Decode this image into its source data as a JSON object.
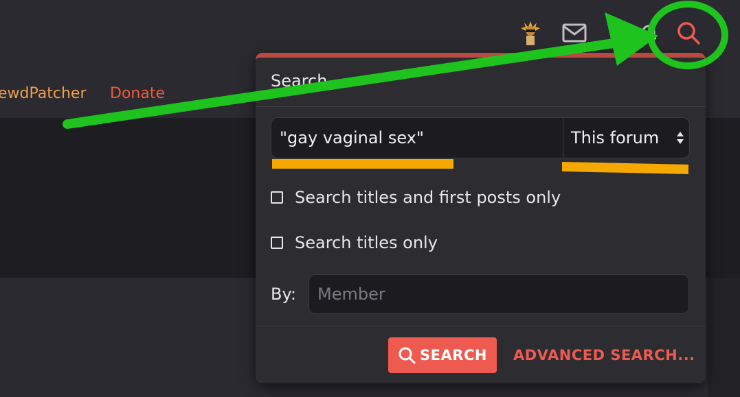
{
  "nav": {
    "partial_link": "ewdPatcher",
    "donate": "Donate"
  },
  "header_icons": [
    "avatar",
    "envelope-icon",
    "bell-icon",
    "search-icon"
  ],
  "popup": {
    "title": "Search",
    "query_value": "\"gay vaginal sex\"",
    "scope_value": "This forum",
    "option_titles_first_posts": "Search titles and first posts only",
    "option_titles_only": "Search titles only",
    "by_label": "By:",
    "member_placeholder": "Member",
    "search_button": "SEARCH",
    "advanced_search": "ADVANCED SEARCH..."
  },
  "colors": {
    "accent": "#ef5a50",
    "annotation_green": "#1ec31e",
    "annotation_orange": "#f5a800",
    "nav_link": "#f0a04a"
  }
}
